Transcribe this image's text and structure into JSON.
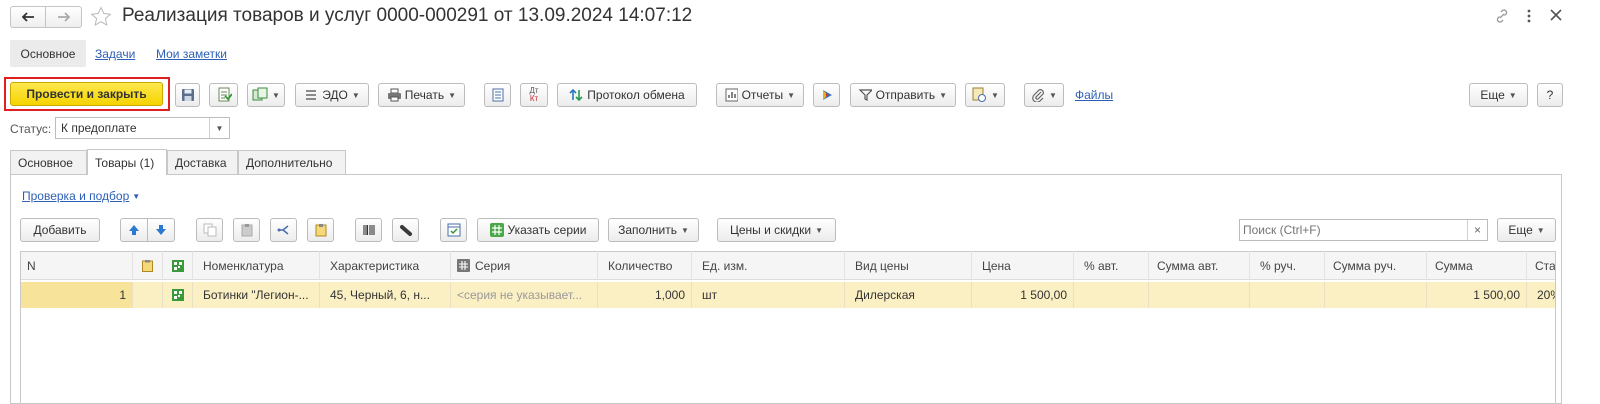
{
  "window": {
    "title": "Реализация товаров и услуг 0000-000291 от 13.09.2024 14:07:12",
    "back_icon": "arrow-left-icon",
    "forward_icon": "arrow-right-icon",
    "favorite_icon": "star-icon",
    "link_icon": "link-icon",
    "menu_icon": "vertical-dots-icon",
    "close_icon": "close-icon"
  },
  "nav_tabs": [
    {
      "label": "Основное",
      "active": true
    },
    {
      "label": "Задачи",
      "active": false
    },
    {
      "label": "Мои заметки",
      "active": false
    }
  ],
  "toolbar": {
    "post_close_label": "Провести и закрыть",
    "edo_label": "ЭДО",
    "print_label": "Печать",
    "dt_label": "Дт",
    "kt_label": "Кт",
    "exchange_label": "Протокол обмена",
    "reports_label": "Отчеты",
    "send_label": "Отправить",
    "files_label": "Файлы",
    "more_label": "Еще",
    "help_label": "?"
  },
  "status": {
    "label": "Статус:",
    "value": "К предоплате"
  },
  "doc_tabs": [
    {
      "label": "Основное",
      "active": false
    },
    {
      "label": "Товары (1)",
      "active": true
    },
    {
      "label": "Доставка",
      "active": false
    },
    {
      "label": "Дополнительно",
      "active": false
    }
  ],
  "goods": {
    "check_link": "Проверка и подбор",
    "add_label": "Добавить",
    "series_label": "Указать серии",
    "fill_label": "Заполнить",
    "prices_label": "Цены и скидки",
    "search_placeholder": "Поиск (Ctrl+F)",
    "search_clear": "×",
    "more_label": "Еще"
  },
  "table": {
    "columns": [
      "N",
      "",
      "",
      "Номенклатура",
      "Характеристика",
      "Серия",
      "Количество",
      "Ед. изм.",
      "Вид цены",
      "Цена",
      "% авт.",
      "Сумма авт.",
      "% руч.",
      "Сумма руч.",
      "Сумма",
      "Ста"
    ],
    "rows": [
      [
        "1",
        "",
        "",
        "Ботинки \"Легион-...",
        "45, Черный, 6, н...",
        "<серия не указывает...",
        "1,000",
        "шт",
        "Дилерская",
        "1 500,00",
        "",
        "",
        "",
        "",
        "1 500,00",
        "20%"
      ]
    ]
  },
  "colors": {
    "accent_yellow": "#f5d400",
    "highlight_red": "#e02020",
    "row_selected": "#fbf0c4",
    "link_blue": "#2d5fb5"
  }
}
